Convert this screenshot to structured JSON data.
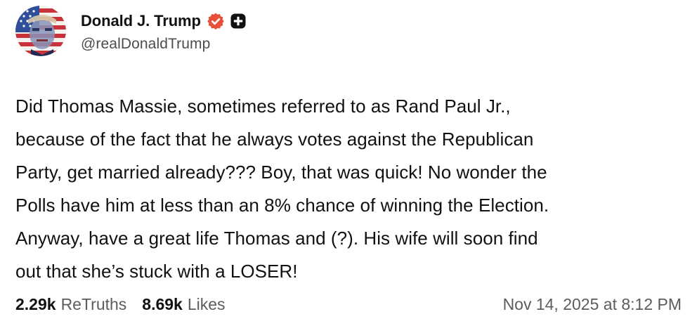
{
  "author": {
    "display_name": "Donald J. Trump",
    "handle": "@realDonaldTrump",
    "avatar_icon": "flag-portrait-avatar",
    "verified_icon": "verified-badge-icon",
    "verified_color": "#e8503a",
    "plus_icon": "plus-badge-icon"
  },
  "post": {
    "lines": [
      "Did Thomas Massie, sometimes referred to as Rand Paul Jr.,",
      "because of the fact that he always votes against the Republican",
      "Party, get married already??? Boy, that was quick! No wonder the",
      "Polls have him at less than an 8% chance of winning the Election.",
      "Anyway, have a great life Thomas and (?). His wife will soon find",
      "out that she’s stuck with a LOSER!"
    ]
  },
  "stats": {
    "retruths_count": "2.29k",
    "retruths_label": "ReTruths",
    "likes_count": "8.69k",
    "likes_label": "Likes"
  },
  "timestamp": "Nov 14, 2025 at 8:12 PM"
}
